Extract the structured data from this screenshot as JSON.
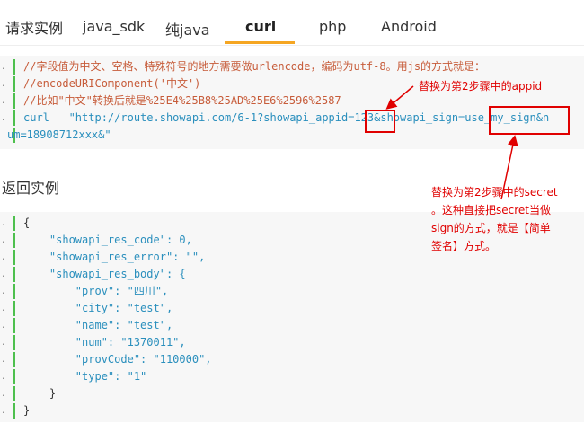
{
  "tabs": {
    "heading": "请求实例",
    "items": [
      {
        "label": "java_sdk",
        "active": false
      },
      {
        "label": "纯java",
        "active": false
      },
      {
        "label": "curl",
        "active": true
      },
      {
        "label": "php",
        "active": false
      },
      {
        "label": "Android",
        "active": false
      }
    ]
  },
  "request_code": {
    "lines": [
      "//字段值为中文、空格、特殊符号的地方需要做urlencode，编码为utf-8。用js的方式就是：",
      "//encodeURIComponent('中文')",
      "//比如\"中文\"转换后就是%25E4%25B8%25AD%25E6%2596%2587",
      "curl   \"http://route.showapi.com/6-1?showapi_appid=123&showapi_sign=use_my_sign&n",
      "um=18908712xxx&\""
    ]
  },
  "response_heading": "返回实例",
  "response_code": {
    "lines": [
      "{",
      "    \"showapi_res_code\": 0,",
      "    \"showapi_res_error\": \"\",",
      "    \"showapi_res_body\": {",
      "        \"prov\": \"四川\",",
      "        \"city\": \"test\",",
      "        \"name\": \"test\",",
      "        \"num\": \"1370011\",",
      "        \"provCode\": \"110000\",",
      "        \"type\": \"1\"",
      "    }",
      "}"
    ]
  },
  "annotations": {
    "appid": "替换为第2步骤中的appid",
    "secret": [
      "替换为第2步骤中的secret",
      "。这种直接把secret当做",
      "sign的方式，就是【简单",
      "签名】方式。"
    ]
  },
  "gutter_mark": ".",
  "colors": {
    "accent": "#f5a623",
    "annotation": "#e00000",
    "line_bar": "#4ec04e",
    "comment": "#c75c3a"
  }
}
